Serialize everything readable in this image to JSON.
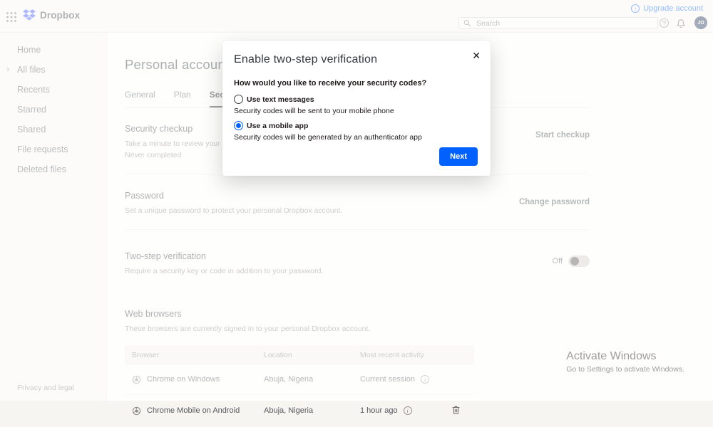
{
  "topbar": {
    "brand": "Dropbox",
    "upgrade_label": "Upgrade account",
    "search_placeholder": "Search",
    "avatar_initials": "JO"
  },
  "icons": {
    "chevron_right": "›",
    "help": "?",
    "up_arrow": "↑",
    "info": "i",
    "close": "✕"
  },
  "sidebar": {
    "items": [
      {
        "label": "Home"
      },
      {
        "label": "All files"
      },
      {
        "label": "Recents"
      },
      {
        "label": "Starred"
      },
      {
        "label": "Shared"
      },
      {
        "label": "File requests"
      },
      {
        "label": "Deleted files"
      }
    ],
    "footer_link": "Privacy and legal"
  },
  "main": {
    "title": "Personal account",
    "tabs": [
      {
        "label": "General"
      },
      {
        "label": "Plan"
      },
      {
        "label": "Security"
      }
    ],
    "sections": {
      "security_checkup": {
        "title": "Security checkup",
        "desc": "Take a minute to review your Dropbox security settings.",
        "status": "Never completed",
        "action": "Start checkup"
      },
      "password": {
        "title": "Password",
        "desc": "Set a unique password to protect your personal Dropbox account.",
        "action": "Change password"
      },
      "two_step": {
        "title": "Two-step verification",
        "desc": "Require a security key or code in addition to your password.",
        "toggle_label": "Off",
        "toggle_state": "off"
      },
      "web_browsers": {
        "title": "Web browsers",
        "desc": "These browsers are currently signed in to your personal Dropbox account.",
        "columns": [
          "Browser",
          "Location",
          "Most recent activity",
          ""
        ],
        "rows": [
          {
            "browser": "Chrome on Windows",
            "location": "Abuja, Nigeria",
            "activity": "Current session"
          },
          {
            "browser": "Chrome Mobile on Android",
            "location": "Abuja, Nigeria",
            "activity": "1 hour ago"
          }
        ]
      }
    }
  },
  "modal": {
    "title": "Enable two-step verification",
    "question": "How would you like to receive your security codes?",
    "options": [
      {
        "label": "Use text messages",
        "desc": "Security codes will be sent to your mobile phone",
        "selected": false
      },
      {
        "label": "Use a mobile app",
        "desc": "Security codes will be generated by an authenticator app",
        "selected": true
      }
    ],
    "next_label": "Next"
  },
  "watermark": {
    "line1": "Activate Windows",
    "line2": "Go to Settings to activate Windows."
  },
  "colors": {
    "accent": "#0061fe"
  }
}
